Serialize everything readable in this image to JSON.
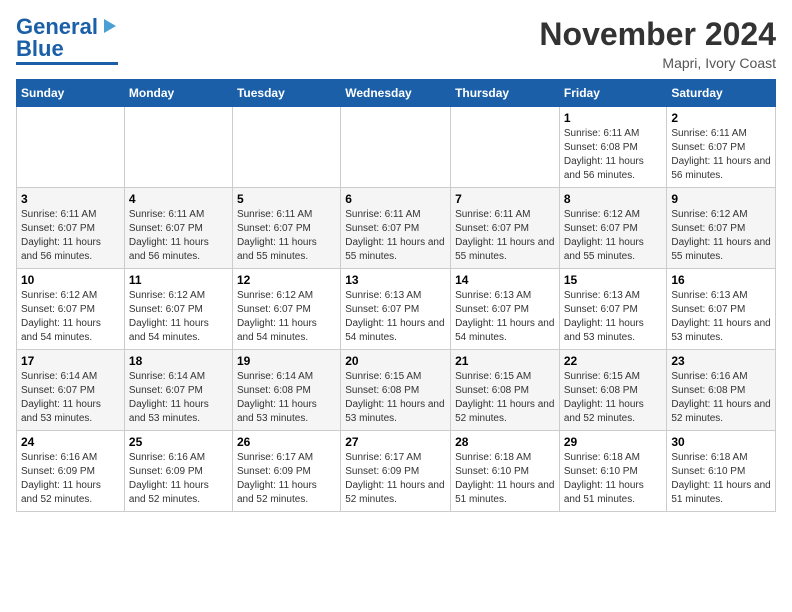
{
  "header": {
    "logo": {
      "line1": "General",
      "line2": "Blue"
    },
    "title": "November 2024",
    "location": "Mapri, Ivory Coast"
  },
  "weekdays": [
    "Sunday",
    "Monday",
    "Tuesday",
    "Wednesday",
    "Thursday",
    "Friday",
    "Saturday"
  ],
  "weeks": [
    [
      {
        "day": null
      },
      {
        "day": null
      },
      {
        "day": null
      },
      {
        "day": null
      },
      {
        "day": null
      },
      {
        "day": 1,
        "sunrise": "Sunrise: 6:11 AM",
        "sunset": "Sunset: 6:08 PM",
        "daylight": "Daylight: 11 hours and 56 minutes."
      },
      {
        "day": 2,
        "sunrise": "Sunrise: 6:11 AM",
        "sunset": "Sunset: 6:07 PM",
        "daylight": "Daylight: 11 hours and 56 minutes."
      }
    ],
    [
      {
        "day": 3,
        "sunrise": "Sunrise: 6:11 AM",
        "sunset": "Sunset: 6:07 PM",
        "daylight": "Daylight: 11 hours and 56 minutes."
      },
      {
        "day": 4,
        "sunrise": "Sunrise: 6:11 AM",
        "sunset": "Sunset: 6:07 PM",
        "daylight": "Daylight: 11 hours and 56 minutes."
      },
      {
        "day": 5,
        "sunrise": "Sunrise: 6:11 AM",
        "sunset": "Sunset: 6:07 PM",
        "daylight": "Daylight: 11 hours and 55 minutes."
      },
      {
        "day": 6,
        "sunrise": "Sunrise: 6:11 AM",
        "sunset": "Sunset: 6:07 PM",
        "daylight": "Daylight: 11 hours and 55 minutes."
      },
      {
        "day": 7,
        "sunrise": "Sunrise: 6:11 AM",
        "sunset": "Sunset: 6:07 PM",
        "daylight": "Daylight: 11 hours and 55 minutes."
      },
      {
        "day": 8,
        "sunrise": "Sunrise: 6:12 AM",
        "sunset": "Sunset: 6:07 PM",
        "daylight": "Daylight: 11 hours and 55 minutes."
      },
      {
        "day": 9,
        "sunrise": "Sunrise: 6:12 AM",
        "sunset": "Sunset: 6:07 PM",
        "daylight": "Daylight: 11 hours and 55 minutes."
      }
    ],
    [
      {
        "day": 10,
        "sunrise": "Sunrise: 6:12 AM",
        "sunset": "Sunset: 6:07 PM",
        "daylight": "Daylight: 11 hours and 54 minutes."
      },
      {
        "day": 11,
        "sunrise": "Sunrise: 6:12 AM",
        "sunset": "Sunset: 6:07 PM",
        "daylight": "Daylight: 11 hours and 54 minutes."
      },
      {
        "day": 12,
        "sunrise": "Sunrise: 6:12 AM",
        "sunset": "Sunset: 6:07 PM",
        "daylight": "Daylight: 11 hours and 54 minutes."
      },
      {
        "day": 13,
        "sunrise": "Sunrise: 6:13 AM",
        "sunset": "Sunset: 6:07 PM",
        "daylight": "Daylight: 11 hours and 54 minutes."
      },
      {
        "day": 14,
        "sunrise": "Sunrise: 6:13 AM",
        "sunset": "Sunset: 6:07 PM",
        "daylight": "Daylight: 11 hours and 54 minutes."
      },
      {
        "day": 15,
        "sunrise": "Sunrise: 6:13 AM",
        "sunset": "Sunset: 6:07 PM",
        "daylight": "Daylight: 11 hours and 53 minutes."
      },
      {
        "day": 16,
        "sunrise": "Sunrise: 6:13 AM",
        "sunset": "Sunset: 6:07 PM",
        "daylight": "Daylight: 11 hours and 53 minutes."
      }
    ],
    [
      {
        "day": 17,
        "sunrise": "Sunrise: 6:14 AM",
        "sunset": "Sunset: 6:07 PM",
        "daylight": "Daylight: 11 hours and 53 minutes."
      },
      {
        "day": 18,
        "sunrise": "Sunrise: 6:14 AM",
        "sunset": "Sunset: 6:07 PM",
        "daylight": "Daylight: 11 hours and 53 minutes."
      },
      {
        "day": 19,
        "sunrise": "Sunrise: 6:14 AM",
        "sunset": "Sunset: 6:08 PM",
        "daylight": "Daylight: 11 hours and 53 minutes."
      },
      {
        "day": 20,
        "sunrise": "Sunrise: 6:15 AM",
        "sunset": "Sunset: 6:08 PM",
        "daylight": "Daylight: 11 hours and 53 minutes."
      },
      {
        "day": 21,
        "sunrise": "Sunrise: 6:15 AM",
        "sunset": "Sunset: 6:08 PM",
        "daylight": "Daylight: 11 hours and 52 minutes."
      },
      {
        "day": 22,
        "sunrise": "Sunrise: 6:15 AM",
        "sunset": "Sunset: 6:08 PM",
        "daylight": "Daylight: 11 hours and 52 minutes."
      },
      {
        "day": 23,
        "sunrise": "Sunrise: 6:16 AM",
        "sunset": "Sunset: 6:08 PM",
        "daylight": "Daylight: 11 hours and 52 minutes."
      }
    ],
    [
      {
        "day": 24,
        "sunrise": "Sunrise: 6:16 AM",
        "sunset": "Sunset: 6:09 PM",
        "daylight": "Daylight: 11 hours and 52 minutes."
      },
      {
        "day": 25,
        "sunrise": "Sunrise: 6:16 AM",
        "sunset": "Sunset: 6:09 PM",
        "daylight": "Daylight: 11 hours and 52 minutes."
      },
      {
        "day": 26,
        "sunrise": "Sunrise: 6:17 AM",
        "sunset": "Sunset: 6:09 PM",
        "daylight": "Daylight: 11 hours and 52 minutes."
      },
      {
        "day": 27,
        "sunrise": "Sunrise: 6:17 AM",
        "sunset": "Sunset: 6:09 PM",
        "daylight": "Daylight: 11 hours and 52 minutes."
      },
      {
        "day": 28,
        "sunrise": "Sunrise: 6:18 AM",
        "sunset": "Sunset: 6:10 PM",
        "daylight": "Daylight: 11 hours and 51 minutes."
      },
      {
        "day": 29,
        "sunrise": "Sunrise: 6:18 AM",
        "sunset": "Sunset: 6:10 PM",
        "daylight": "Daylight: 11 hours and 51 minutes."
      },
      {
        "day": 30,
        "sunrise": "Sunrise: 6:18 AM",
        "sunset": "Sunset: 6:10 PM",
        "daylight": "Daylight: 11 hours and 51 minutes."
      }
    ]
  ]
}
